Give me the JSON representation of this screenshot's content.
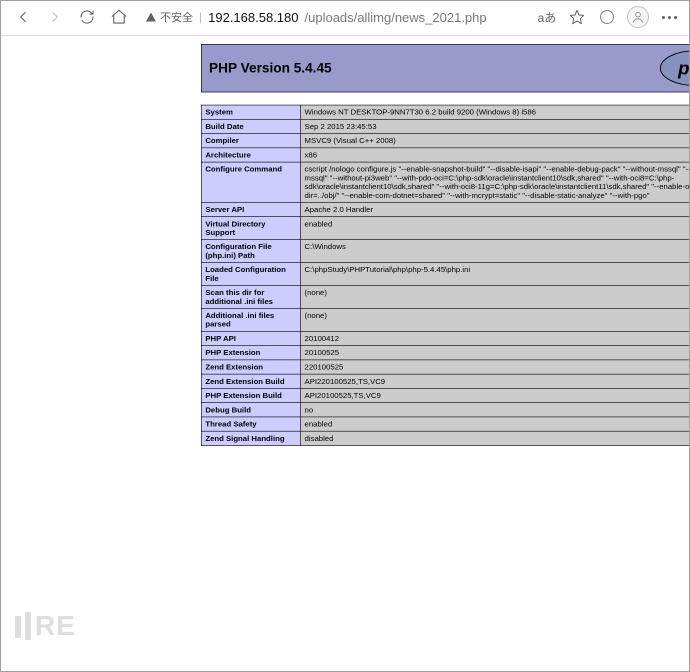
{
  "address": {
    "security_text": "不安全",
    "host": "192.168.58.180",
    "path": "/uploads/allimg/news_2021.php",
    "translate_label": "aあ"
  },
  "phpinfo": {
    "title": "PHP Version 5.4.45",
    "logo_text": "php"
  },
  "rows": [
    {
      "name": "System",
      "value": "Windows NT DESKTOP-9NN7T30 6.2 build 9200 (Windows 8) i586"
    },
    {
      "name": "Build Date",
      "value": "Sep 2 2015 23:45:53"
    },
    {
      "name": "Compiler",
      "value": "MSVC9 (Visual C++ 2008)"
    },
    {
      "name": "Architecture",
      "value": "x86"
    },
    {
      "name": "Configure Command",
      "value": "cscript /nologo configure.js \"--enable-snapshot-build\" \"--disable-isapi\" \"--enable-debug-pack\" \"--without-mssql\" \"--without-pdo-mssql\" \"--without-pi3web\" \"--with-pdo-oci=C:\\php-sdk\\oracle\\instantclient10\\sdk,shared\" \"--with-oci8=C:\\php-sdk\\oracle\\instantclient10\\sdk,shared\" \"--with-oci8-11g=C:\\php-sdk\\oracle\\instantclient11\\sdk,shared\" \"--enable-object-out-dir=../obj/\" \"--enable-com-dotnet=shared\" \"--with-mcrypt=static\" \"--disable-static-analyze\" \"--with-pgo\""
    },
    {
      "name": "Server API",
      "value": "Apache 2.0 Handler"
    },
    {
      "name": "Virtual Directory Support",
      "value": "enabled"
    },
    {
      "name": "Configuration File (php.ini) Path",
      "value": "C:\\Windows"
    },
    {
      "name": "Loaded Configuration File",
      "value": "C:\\phpStudy\\PHPTutorial\\php\\php-5.4.45\\php.ini"
    },
    {
      "name": "Scan this dir for additional .ini files",
      "value": "(none)"
    },
    {
      "name": "Additional .ini files parsed",
      "value": "(none)"
    },
    {
      "name": "PHP API",
      "value": "20100412"
    },
    {
      "name": "PHP Extension",
      "value": "20100525"
    },
    {
      "name": "Zend Extension",
      "value": "220100525"
    },
    {
      "name": "Zend Extension Build",
      "value": "API220100525,TS,VC9"
    },
    {
      "name": "PHP Extension Build",
      "value": "API20100525,TS,VC9"
    },
    {
      "name": "Debug Build",
      "value": "no"
    },
    {
      "name": "Thread Safety",
      "value": "enabled"
    },
    {
      "name": "Zend Signal Handling",
      "value": "disabled"
    }
  ],
  "watermark_text": "RE"
}
